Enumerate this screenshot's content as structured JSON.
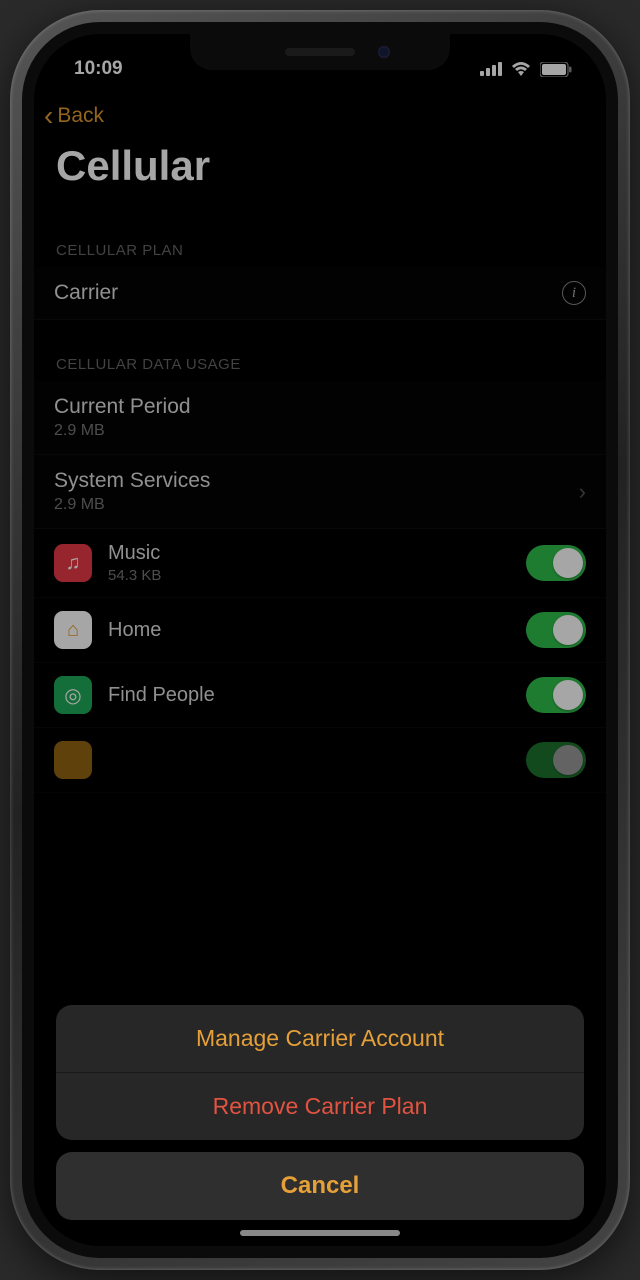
{
  "status_bar": {
    "time": "10:09"
  },
  "nav": {
    "back_label": "Back"
  },
  "page_title": "Cellular",
  "sections": {
    "plan_header": "CELLULAR PLAN",
    "usage_header": "CELLULAR DATA USAGE",
    "carrier_label": "Carrier",
    "current_period": {
      "title": "Current Period",
      "value": "2.9 MB"
    },
    "system_services": {
      "title": "System Services",
      "value": "2.9 MB"
    }
  },
  "apps": [
    {
      "name": "Music",
      "usage": "54.3 KB",
      "color": "#e63946",
      "icon_glyph": "♫",
      "toggle": true
    },
    {
      "name": "Home",
      "usage": "",
      "color": "#ffffff",
      "icon_glyph": "⌂",
      "toggle": true
    },
    {
      "name": "Find People",
      "usage": "",
      "color": "#1faa59",
      "icon_glyph": "◎",
      "toggle": true
    }
  ],
  "action_sheet": {
    "manage_label": "Manage Carrier Account",
    "remove_label": "Remove Carrier Plan",
    "cancel_label": "Cancel"
  }
}
